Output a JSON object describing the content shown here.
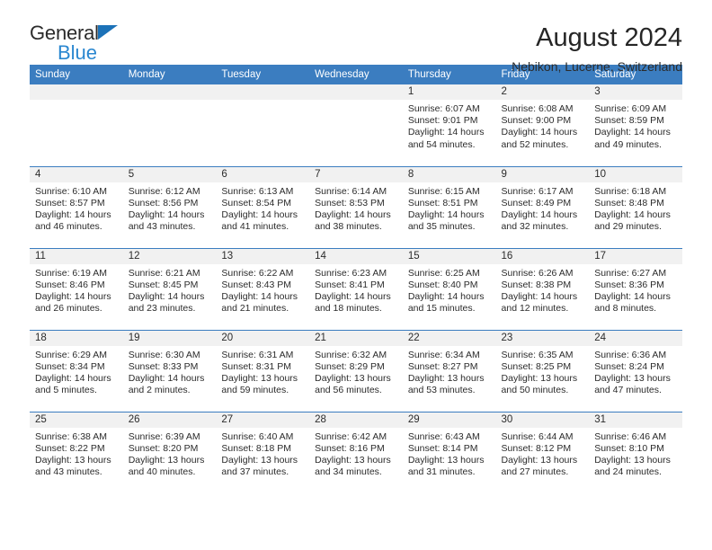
{
  "brand": {
    "name_top": "General",
    "name_bottom": "Blue",
    "triangle_color": "#1c72b8",
    "blue_text_color": "#2a87d0"
  },
  "header": {
    "title": "August 2024",
    "subtitle": "Nebikon, Lucerne, Switzerland"
  },
  "colors": {
    "header_blue": "#3b7dc0",
    "daynum_bar": "#f1f1f1",
    "text": "#2b2b2b"
  },
  "weekdays": [
    "Sunday",
    "Monday",
    "Tuesday",
    "Wednesday",
    "Thursday",
    "Friday",
    "Saturday"
  ],
  "labels": {
    "sunrise_prefix": "Sunrise:",
    "sunset_prefix": "Sunset:",
    "daylight_prefix": "Daylight:"
  },
  "weeks": [
    [
      {
        "day": "",
        "sunrise": "",
        "sunset": "",
        "daylight_first": "",
        "daylight_second": ""
      },
      {
        "day": "",
        "sunrise": "",
        "sunset": "",
        "daylight_first": "",
        "daylight_second": ""
      },
      {
        "day": "",
        "sunrise": "",
        "sunset": "",
        "daylight_first": "",
        "daylight_second": ""
      },
      {
        "day": "",
        "sunrise": "",
        "sunset": "",
        "daylight_first": "",
        "daylight_second": ""
      },
      {
        "day": "1",
        "sunrise": "Sunrise: 6:07 AM",
        "sunset": "Sunset: 9:01 PM",
        "daylight_first": "Daylight: 14 hours",
        "daylight_second": "and 54 minutes."
      },
      {
        "day": "2",
        "sunrise": "Sunrise: 6:08 AM",
        "sunset": "Sunset: 9:00 PM",
        "daylight_first": "Daylight: 14 hours",
        "daylight_second": "and 52 minutes."
      },
      {
        "day": "3",
        "sunrise": "Sunrise: 6:09 AM",
        "sunset": "Sunset: 8:59 PM",
        "daylight_first": "Daylight: 14 hours",
        "daylight_second": "and 49 minutes."
      }
    ],
    [
      {
        "day": "4",
        "sunrise": "Sunrise: 6:10 AM",
        "sunset": "Sunset: 8:57 PM",
        "daylight_first": "Daylight: 14 hours",
        "daylight_second": "and 46 minutes."
      },
      {
        "day": "5",
        "sunrise": "Sunrise: 6:12 AM",
        "sunset": "Sunset: 8:56 PM",
        "daylight_first": "Daylight: 14 hours",
        "daylight_second": "and 43 minutes."
      },
      {
        "day": "6",
        "sunrise": "Sunrise: 6:13 AM",
        "sunset": "Sunset: 8:54 PM",
        "daylight_first": "Daylight: 14 hours",
        "daylight_second": "and 41 minutes."
      },
      {
        "day": "7",
        "sunrise": "Sunrise: 6:14 AM",
        "sunset": "Sunset: 8:53 PM",
        "daylight_first": "Daylight: 14 hours",
        "daylight_second": "and 38 minutes."
      },
      {
        "day": "8",
        "sunrise": "Sunrise: 6:15 AM",
        "sunset": "Sunset: 8:51 PM",
        "daylight_first": "Daylight: 14 hours",
        "daylight_second": "and 35 minutes."
      },
      {
        "day": "9",
        "sunrise": "Sunrise: 6:17 AM",
        "sunset": "Sunset: 8:49 PM",
        "daylight_first": "Daylight: 14 hours",
        "daylight_second": "and 32 minutes."
      },
      {
        "day": "10",
        "sunrise": "Sunrise: 6:18 AM",
        "sunset": "Sunset: 8:48 PM",
        "daylight_first": "Daylight: 14 hours",
        "daylight_second": "and 29 minutes."
      }
    ],
    [
      {
        "day": "11",
        "sunrise": "Sunrise: 6:19 AM",
        "sunset": "Sunset: 8:46 PM",
        "daylight_first": "Daylight: 14 hours",
        "daylight_second": "and 26 minutes."
      },
      {
        "day": "12",
        "sunrise": "Sunrise: 6:21 AM",
        "sunset": "Sunset: 8:45 PM",
        "daylight_first": "Daylight: 14 hours",
        "daylight_second": "and 23 minutes."
      },
      {
        "day": "13",
        "sunrise": "Sunrise: 6:22 AM",
        "sunset": "Sunset: 8:43 PM",
        "daylight_first": "Daylight: 14 hours",
        "daylight_second": "and 21 minutes."
      },
      {
        "day": "14",
        "sunrise": "Sunrise: 6:23 AM",
        "sunset": "Sunset: 8:41 PM",
        "daylight_first": "Daylight: 14 hours",
        "daylight_second": "and 18 minutes."
      },
      {
        "day": "15",
        "sunrise": "Sunrise: 6:25 AM",
        "sunset": "Sunset: 8:40 PM",
        "daylight_first": "Daylight: 14 hours",
        "daylight_second": "and 15 minutes."
      },
      {
        "day": "16",
        "sunrise": "Sunrise: 6:26 AM",
        "sunset": "Sunset: 8:38 PM",
        "daylight_first": "Daylight: 14 hours",
        "daylight_second": "and 12 minutes."
      },
      {
        "day": "17",
        "sunrise": "Sunrise: 6:27 AM",
        "sunset": "Sunset: 8:36 PM",
        "daylight_first": "Daylight: 14 hours",
        "daylight_second": "and 8 minutes."
      }
    ],
    [
      {
        "day": "18",
        "sunrise": "Sunrise: 6:29 AM",
        "sunset": "Sunset: 8:34 PM",
        "daylight_first": "Daylight: 14 hours",
        "daylight_second": "and 5 minutes."
      },
      {
        "day": "19",
        "sunrise": "Sunrise: 6:30 AM",
        "sunset": "Sunset: 8:33 PM",
        "daylight_first": "Daylight: 14 hours",
        "daylight_second": "and 2 minutes."
      },
      {
        "day": "20",
        "sunrise": "Sunrise: 6:31 AM",
        "sunset": "Sunset: 8:31 PM",
        "daylight_first": "Daylight: 13 hours",
        "daylight_second": "and 59 minutes."
      },
      {
        "day": "21",
        "sunrise": "Sunrise: 6:32 AM",
        "sunset": "Sunset: 8:29 PM",
        "daylight_first": "Daylight: 13 hours",
        "daylight_second": "and 56 minutes."
      },
      {
        "day": "22",
        "sunrise": "Sunrise: 6:34 AM",
        "sunset": "Sunset: 8:27 PM",
        "daylight_first": "Daylight: 13 hours",
        "daylight_second": "and 53 minutes."
      },
      {
        "day": "23",
        "sunrise": "Sunrise: 6:35 AM",
        "sunset": "Sunset: 8:25 PM",
        "daylight_first": "Daylight: 13 hours",
        "daylight_second": "and 50 minutes."
      },
      {
        "day": "24",
        "sunrise": "Sunrise: 6:36 AM",
        "sunset": "Sunset: 8:24 PM",
        "daylight_first": "Daylight: 13 hours",
        "daylight_second": "and 47 minutes."
      }
    ],
    [
      {
        "day": "25",
        "sunrise": "Sunrise: 6:38 AM",
        "sunset": "Sunset: 8:22 PM",
        "daylight_first": "Daylight: 13 hours",
        "daylight_second": "and 43 minutes."
      },
      {
        "day": "26",
        "sunrise": "Sunrise: 6:39 AM",
        "sunset": "Sunset: 8:20 PM",
        "daylight_first": "Daylight: 13 hours",
        "daylight_second": "and 40 minutes."
      },
      {
        "day": "27",
        "sunrise": "Sunrise: 6:40 AM",
        "sunset": "Sunset: 8:18 PM",
        "daylight_first": "Daylight: 13 hours",
        "daylight_second": "and 37 minutes."
      },
      {
        "day": "28",
        "sunrise": "Sunrise: 6:42 AM",
        "sunset": "Sunset: 8:16 PM",
        "daylight_first": "Daylight: 13 hours",
        "daylight_second": "and 34 minutes."
      },
      {
        "day": "29",
        "sunrise": "Sunrise: 6:43 AM",
        "sunset": "Sunset: 8:14 PM",
        "daylight_first": "Daylight: 13 hours",
        "daylight_second": "and 31 minutes."
      },
      {
        "day": "30",
        "sunrise": "Sunrise: 6:44 AM",
        "sunset": "Sunset: 8:12 PM",
        "daylight_first": "Daylight: 13 hours",
        "daylight_second": "and 27 minutes."
      },
      {
        "day": "31",
        "sunrise": "Sunrise: 6:46 AM",
        "sunset": "Sunset: 8:10 PM",
        "daylight_first": "Daylight: 13 hours",
        "daylight_second": "and 24 minutes."
      }
    ]
  ]
}
